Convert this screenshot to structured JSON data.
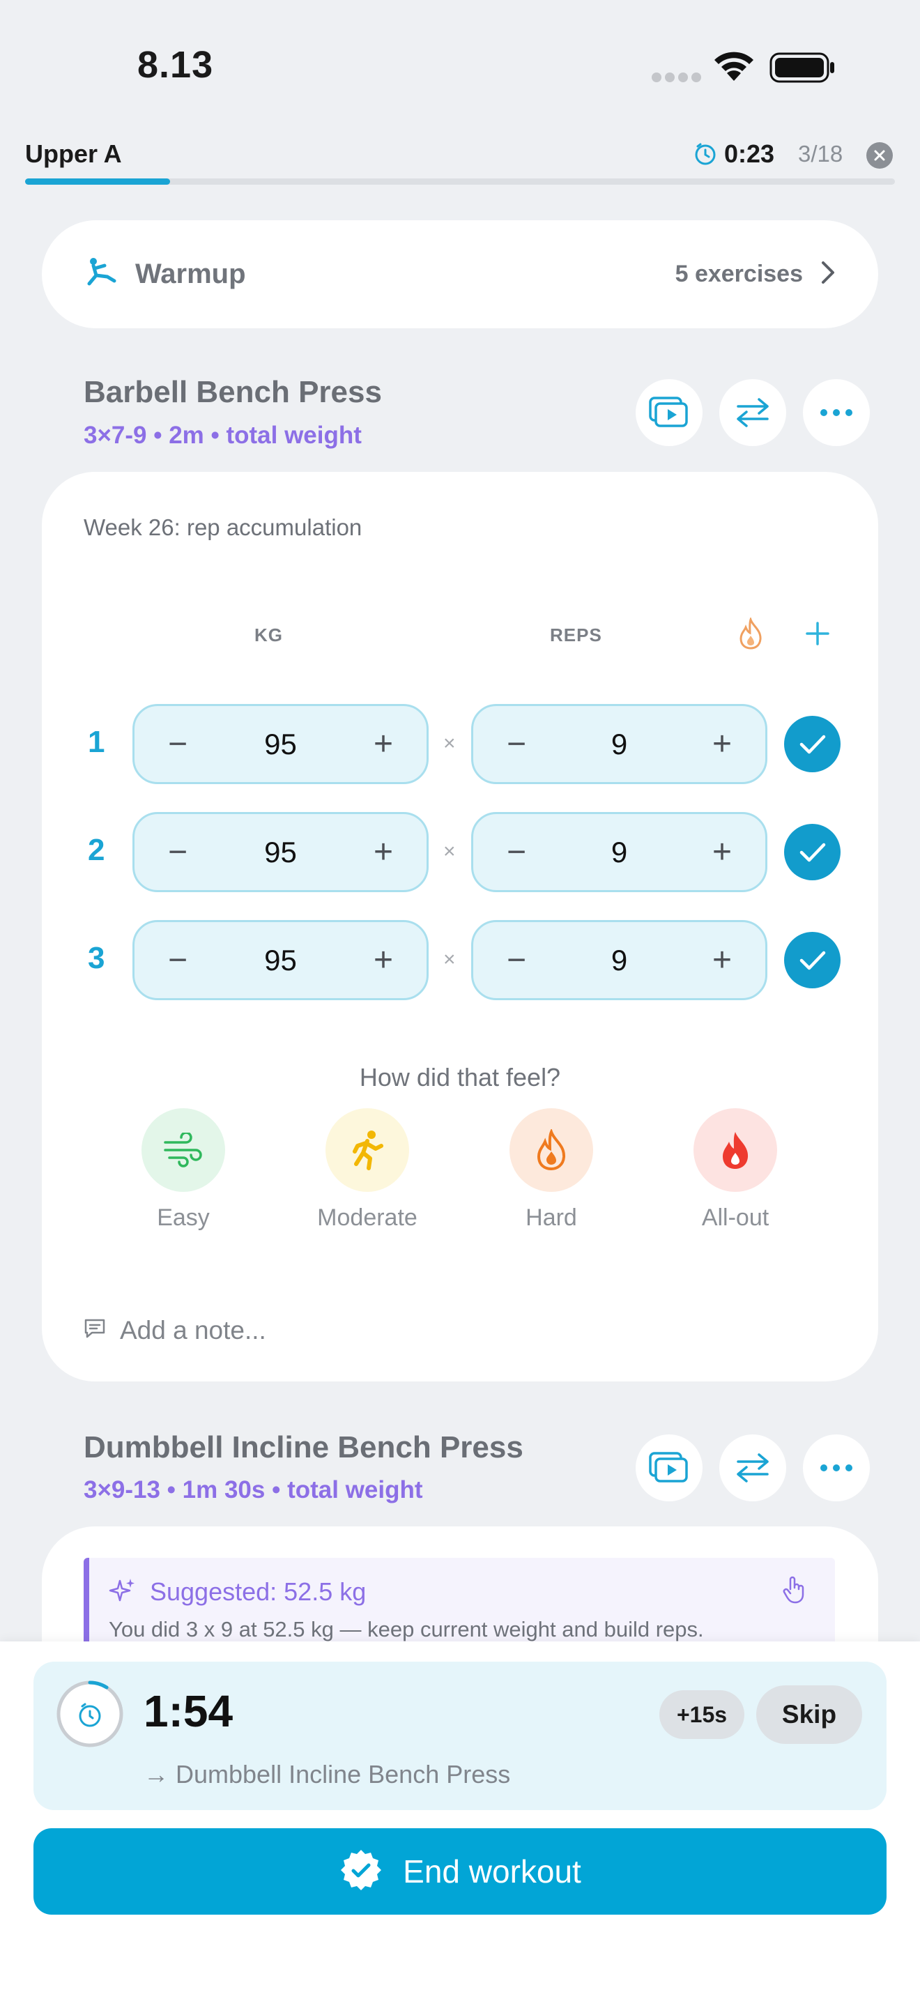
{
  "status_bar": {
    "time": "8.13"
  },
  "header": {
    "workout_name": "Upper A",
    "elapsed": "0:23",
    "progress_count": "3/18",
    "progress_fraction": 0.167
  },
  "warmup": {
    "label": "Warmup",
    "count": "5 exercises"
  },
  "exercise1": {
    "title": "Barbell Bench Press",
    "subtitle": "3×7-9 • 2m • total weight",
    "week_note": "Week 26: rep accumulation",
    "col_kg": "KG",
    "col_reps": "REPS",
    "sets": [
      {
        "num": "1",
        "kg": "95",
        "reps": "9"
      },
      {
        "num": "2",
        "kg": "95",
        "reps": "9"
      },
      {
        "num": "3",
        "kg": "95",
        "reps": "9"
      }
    ],
    "times_symbol": "×",
    "minus": "−",
    "plus": "+",
    "feel_question": "How did that feel?",
    "feel_options": [
      {
        "label": "Easy",
        "color": "#2fb85c",
        "bg": "#e3f6e9"
      },
      {
        "label": "Moderate",
        "color": "#f2b705",
        "bg": "#fdf7dc"
      },
      {
        "label": "Hard",
        "color": "#ef7a1f",
        "bg": "#fde9dc"
      },
      {
        "label": "All-out",
        "color": "#ee3b2f",
        "bg": "#fde3e1"
      }
    ],
    "note_placeholder": "Add a note..."
  },
  "exercise2": {
    "title": "Dumbbell Incline Bench Press",
    "subtitle": "3×9-13 • 1m 30s • total weight",
    "suggest_title": "Suggested: 52.5 kg",
    "suggest_body": "You did 3 x 9 at 52.5 kg — keep current weight and build reps."
  },
  "rest_timer": {
    "time": "1:54",
    "next": "→ Dumbbell Incline Bench Press",
    "add_label": "+15s",
    "skip_label": "Skip"
  },
  "end_button": {
    "label": "End workout"
  },
  "colors": {
    "accent": "#1aa4d4",
    "purple": "#8c6fe6",
    "end": "#02a5d6"
  }
}
